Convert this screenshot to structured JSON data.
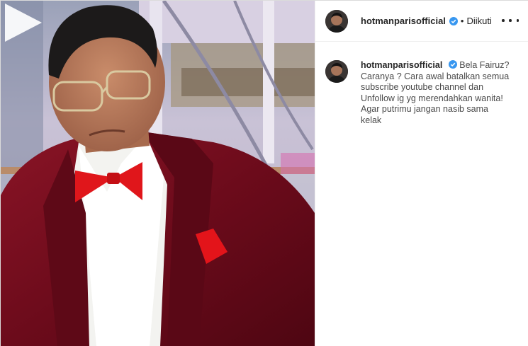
{
  "post": {
    "author": {
      "username": "hotmanparisofficial",
      "verified": true,
      "follow_separator": "•",
      "follow_status": "Diikuti"
    },
    "menu_icon": "more-options-icon",
    "media": {
      "type": "video",
      "play_icon": "play-icon"
    },
    "caption": {
      "username": "hotmanparisofficial",
      "text": "Bela Fairuz?\nCaranya ? Cara awal batalkan semua\nsubscribe youtube channel dan\nUnfollow ig yg merendahkan wanita!\nAgar putrimu jangan nasib sama\nkelak"
    }
  },
  "colors": {
    "verified_blue": "#3897f0",
    "jacket": "#7a0f1e",
    "bow_tie": "#e0161b",
    "text": "#262626"
  }
}
